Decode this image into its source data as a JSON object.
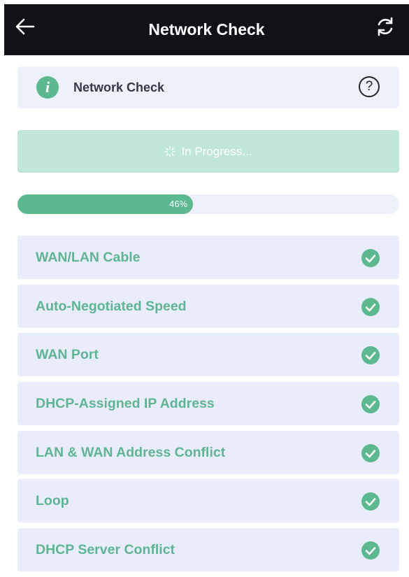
{
  "header": {
    "title": "Network Check",
    "back_icon": "back-arrow-icon",
    "refresh_icon": "refresh-icon"
  },
  "info_card": {
    "label": "Network Check",
    "info_icon": "info-icon",
    "help_icon": "help-icon"
  },
  "progress": {
    "button_label": "In Progress...",
    "percent_label": "46%",
    "percent_value": 0.46
  },
  "checks": [
    {
      "label": "WAN/LAN Cable",
      "status_icon": "check-circle-icon"
    },
    {
      "label": "Auto-Negotiated Speed",
      "status_icon": "check-circle-icon"
    },
    {
      "label": "WAN Port",
      "status_icon": "check-circle-icon"
    },
    {
      "label": "DHCP-Assigned IP Address",
      "status_icon": "check-circle-icon"
    },
    {
      "label": "LAN & WAN Address Conflict",
      "status_icon": "check-circle-icon"
    },
    {
      "label": "Loop",
      "status_icon": "check-circle-icon"
    },
    {
      "label": "DHCP Server Conflict",
      "status_icon": "check-circle-icon"
    }
  ],
  "colors": {
    "accent": "#5bb88f",
    "header_bg": "#101218",
    "card_bg": "#e9edfb",
    "progress_button_bg": "#bfe6d6"
  }
}
